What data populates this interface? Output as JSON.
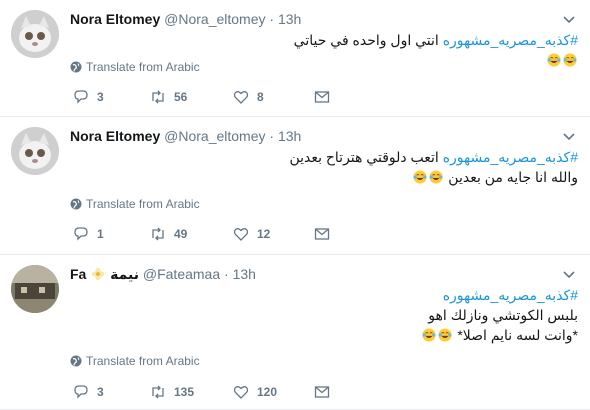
{
  "tweets": [
    {
      "name": "Nora Eltomey",
      "handle": "@Nora_eltomey",
      "time": "13h",
      "hashtag": "#كذبه_مصريه_مشهوره",
      "lines": [
        "انتي اول واحده في حياتي"
      ],
      "emoji_count": 2,
      "translate": "Translate from Arabic",
      "replies": "3",
      "retweets": "56",
      "likes": "8"
    },
    {
      "name": "Nora Eltomey",
      "handle": "@Nora_eltomey",
      "time": "13h",
      "hashtag": "#كذبه_مصريه_مشهوره",
      "lines": [
        "اتعب دلوقتي هترتاح بعدين",
        "والله انا جايه من بعدين"
      ],
      "emoji_count": 2,
      "translate": "Translate from Arabic",
      "replies": "1",
      "retweets": "49",
      "likes": "12"
    },
    {
      "name": "Fa",
      "name_suffix": "نيمة",
      "handle": "@Fateamaa",
      "time": "13h",
      "hashtag": "#كذبه_مصريه_مشهوره",
      "lines": [
        "بلبس الكوتشي ونازلك اهو",
        "*وانت لسه نايم اصلا*"
      ],
      "emoji_count": 2,
      "translate": "Translate from Arabic",
      "replies": "3",
      "retweets": "135",
      "likes": "120"
    }
  ],
  "colors": {
    "link": "#1b95e0",
    "muted": "#657786",
    "text": "#14171a",
    "divider": "#e6ecf0"
  },
  "icons": [
    "reply-icon",
    "retweet-icon",
    "like-icon",
    "direct-message-icon",
    "globe-icon",
    "chevron-down-icon",
    "face-with-tears-of-joy-emoji",
    "flower-emoji"
  ]
}
